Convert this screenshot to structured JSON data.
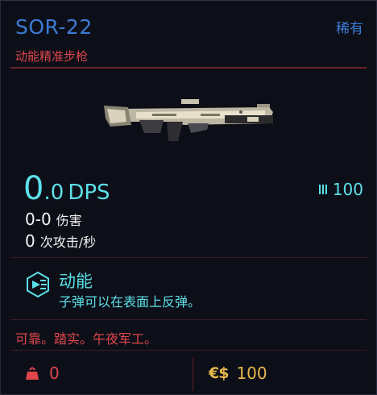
{
  "item": {
    "name": "SOR-22",
    "rarity": "稀有",
    "type": "动能精准步枪"
  },
  "stats": {
    "dps_whole": "0",
    "dps_frac": ".0",
    "dps_unit": "DPS",
    "ammo": "100",
    "damage_value": "0-0",
    "damage_label": "伤害",
    "attack_speed_value": "0",
    "attack_speed_label": "次攻击/秒"
  },
  "mod": {
    "title": "动能",
    "description": "子弹可以在表面上反弹。"
  },
  "flavor": "可靠。踏实。午夜军工。",
  "footer": {
    "weight": "0",
    "currency_symbol": "€$",
    "price": "100"
  },
  "icons": {
    "weapon": "rifle-image",
    "ammo": "ammo-icon",
    "mod": "kinetic-mod-icon",
    "weight": "weight-icon"
  },
  "colors": {
    "rarity_blue": "#3d7bd6",
    "accent_red": "#e0464c",
    "cyan": "#5ce0e8",
    "gold": "#e8b84a"
  }
}
